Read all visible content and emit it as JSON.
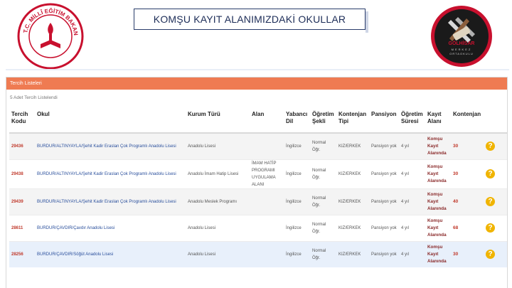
{
  "slide": {
    "title": "KOMŞU KAYIT ALANIMIZDAKİ OKULLAR"
  },
  "logos": {
    "left_text_top": "T.C. MİLLÎ EĞİTİM BAKANLIĞI",
    "right_text_top": "GÖLHİSAR",
    "right_text_mid": "MERKEZ",
    "right_text_bottom": "ORTAOKULU"
  },
  "panel": {
    "header": "Tercih Listeleri",
    "count_text": "5 Adet Tercih Listelendi"
  },
  "table": {
    "columns": [
      "Tercih Kodu",
      "Okul",
      "Kurum Türü",
      "Alan",
      "Yabancı Dil",
      "Öğretim Şekli",
      "Kontenjan Tipi",
      "Pansiyon",
      "Öğretim Süresi",
      "Kayıt Alanı",
      "Kontenjan"
    ],
    "rows": [
      {
        "code": "29436",
        "school": "BURDUR/ALTINYAYLA/Şehit Kadir Eraslan Çok Programlı Anadolu Lisesi",
        "type": "Anadolu Lisesi",
        "area": "",
        "lang": "İngilizce",
        "mode": "Normal Öğr.",
        "quota_type": "KIZ/ERKEK",
        "dorm": "Pansiyon yok",
        "duration": "4 yıl",
        "zone": "Komşu Kayıt Alanında",
        "quota": "30"
      },
      {
        "code": "29438",
        "school": "BURDUR/ALTINYAYLA/Şehit Kadir Eraslan Çok Programlı Anadolu Lisesi",
        "type": "Anadolu İmam Hatip Lisesi",
        "area": "İMAM HATİP PROGRAMI UYGULAMA ALANI",
        "lang": "İngilizce",
        "mode": "Normal Öğr.",
        "quota_type": "KIZ/ERKEK",
        "dorm": "Pansiyon yok",
        "duration": "4 yıl",
        "zone": "Komşu Kayıt Alanında",
        "quota": "30"
      },
      {
        "code": "29439",
        "school": "BURDUR/ALTINYAYLA/Şehit Kadir Eraslan Çok Programlı Anadolu Lisesi",
        "type": "Anadolu Meslek Programı",
        "area": "",
        "lang": "İngilizce",
        "mode": "Normal Öğr.",
        "quota_type": "KIZ/ERKEK",
        "dorm": "Pansiyon yok",
        "duration": "4 yıl",
        "zone": "Komşu Kayıt Alanında",
        "quota": "40"
      },
      {
        "code": "28611",
        "school": "BURDUR/ÇAVDIR/Çavdır Anadolu Lisesi",
        "type": "Anadolu Lisesi",
        "area": "",
        "lang": "İngilizce",
        "mode": "Normal Öğr.",
        "quota_type": "KIZ/ERKEK",
        "dorm": "Pansiyon yok",
        "duration": "4 yıl",
        "zone": "Komşu Kayıt Alanında",
        "quota": "68"
      },
      {
        "code": "28256",
        "school": "BURDUR/ÇAVDIR/Söğüt Anadolu Lisesi",
        "type": "Anadolu Lisesi",
        "area": "",
        "lang": "İngilizce",
        "mode": "Normal Öğr.",
        "quota_type": "KIZ/ERKEK",
        "dorm": "Pansiyon yok",
        "duration": "4 yıl",
        "zone": "Komşu Kayıt Alanında",
        "quota": "30"
      }
    ]
  },
  "icons": {
    "help": "question-icon",
    "help_glyph": "?"
  },
  "colors": {
    "panel_header": "#ef7b52",
    "help": "#f0b400",
    "code": "#c0392b",
    "school_link": "#2a4f9c"
  }
}
